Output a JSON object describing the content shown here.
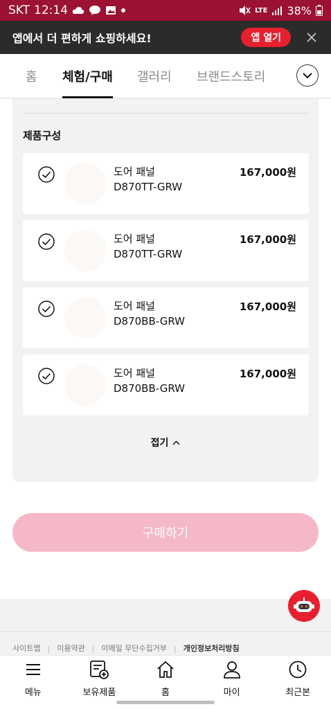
{
  "status_bar": {
    "carrier": "SKT",
    "time": "12:14",
    "network": "LTE",
    "battery": "38%"
  },
  "app_banner": {
    "text": "앱에서 더 편하게 쇼핑하세요!",
    "open_label": "앱 열기"
  },
  "tabs": [
    {
      "label": "홈"
    },
    {
      "label": "체험/구매"
    },
    {
      "label": "갤러리"
    },
    {
      "label": "브랜드스토리"
    }
  ],
  "product_section": {
    "title": "제품구성",
    "items": [
      {
        "name": "도어 패널",
        "code": "D870TT-GRW",
        "price": "167,000원"
      },
      {
        "name": "도어 패널",
        "code": "D870TT-GRW",
        "price": "167,000원"
      },
      {
        "name": "도어 패널",
        "code": "D870BB-GRW",
        "price": "167,000원"
      },
      {
        "name": "도어 패널",
        "code": "D870BB-GRW",
        "price": "167,000원"
      }
    ],
    "collapse_label": "접기"
  },
  "buy_button": {
    "label": "구매하기"
  },
  "footer": {
    "links": [
      "사이트맵",
      "이용약관",
      "이메일 무단수집거부",
      "개인정보처리방침"
    ]
  },
  "bottom_nav": [
    {
      "label": "메뉴",
      "icon": "menu-icon"
    },
    {
      "label": "보유제품",
      "icon": "owned-products-icon"
    },
    {
      "label": "홈",
      "icon": "home-icon"
    },
    {
      "label": "마이",
      "icon": "user-icon"
    },
    {
      "label": "최근본",
      "icon": "clock-icon"
    }
  ],
  "colors": {
    "status_bar": "#9b1232",
    "accent_red": "#e6202e",
    "buy_button_disabled": "#f5b8c6"
  }
}
